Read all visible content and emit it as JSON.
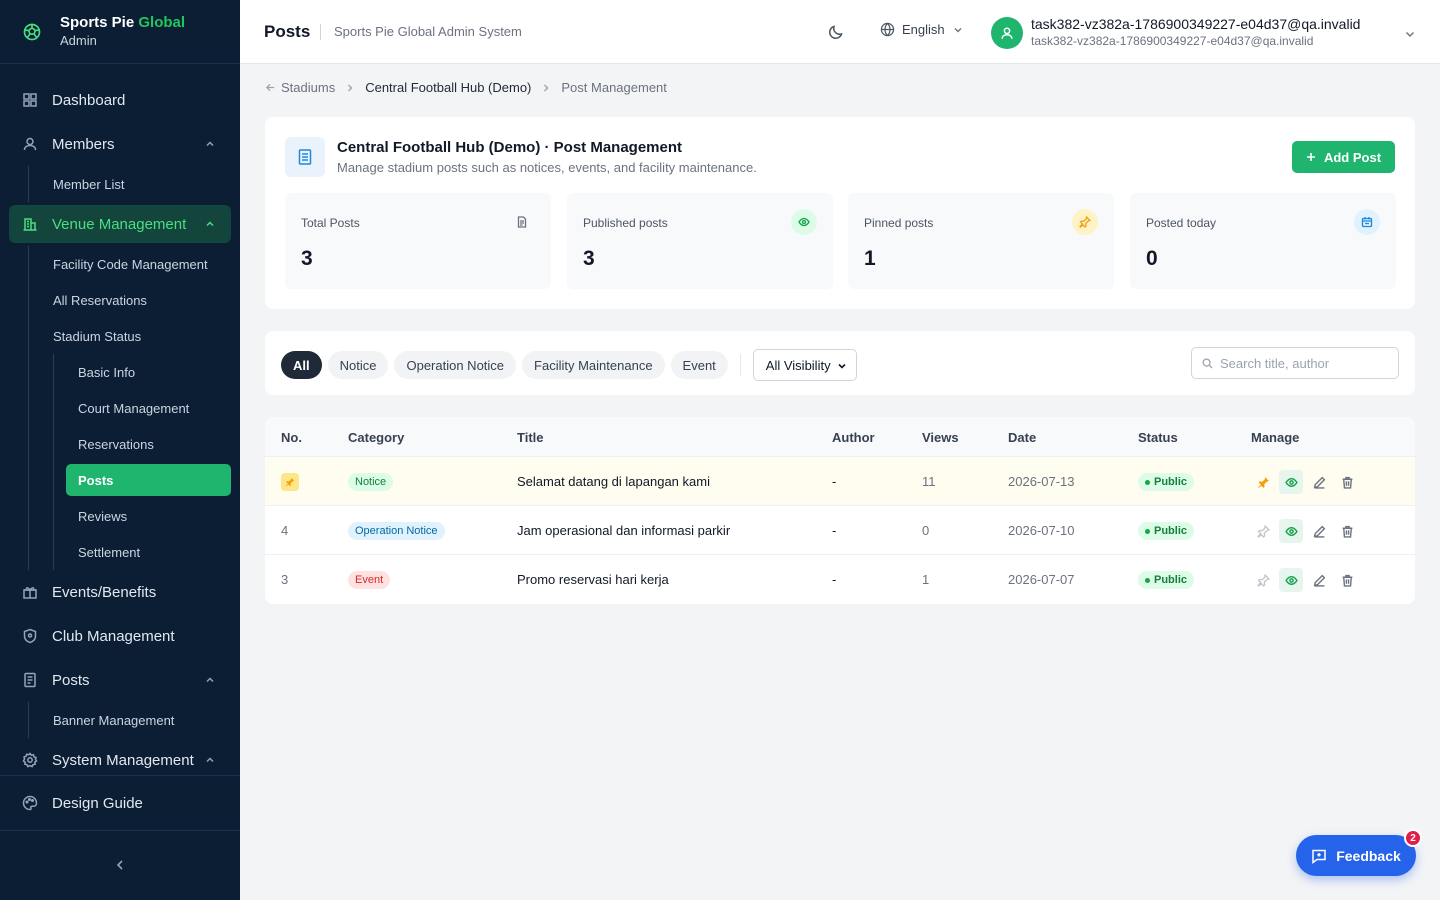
{
  "brand": {
    "name_main": "Sports Pie",
    "name_accent": "Global",
    "subtitle": "Admin"
  },
  "sidebar": {
    "dashboard": "Dashboard",
    "members": "Members",
    "member_list": "Member List",
    "venue_management": "Venue Management",
    "facility_code": "Facility Code Management",
    "all_reservations": "All Reservations",
    "stadium_status": "Stadium Status",
    "basic_info": "Basic Info",
    "court_management": "Court Management",
    "reservations": "Reservations",
    "posts_sub": "Posts",
    "reviews": "Reviews",
    "settlement": "Settlement",
    "events_benefits": "Events/Benefits",
    "club_management": "Club Management",
    "posts": "Posts",
    "banner_management": "Banner Management",
    "system_management": "System Management",
    "design_guide": "Design Guide"
  },
  "header": {
    "title": "Posts",
    "subtitle": "Sports Pie Global Admin System",
    "language": "English",
    "user_name": "task382-vz382a-1786900349227-e04d37@qa.invalid",
    "user_email": "task382-vz382a-1786900349227-e04d37@qa.invalid"
  },
  "breadcrumb": {
    "level1": "Stadiums",
    "level2": "Central Football Hub (Demo)",
    "level3": "Post Management"
  },
  "summary": {
    "title": "Central Football Hub (Demo) · Post Management",
    "description": "Manage stadium posts such as notices, events, and facility maintenance.",
    "add_label": "Add Post",
    "stats": [
      {
        "label": "Total Posts",
        "value": "3",
        "icon": "document-icon",
        "color": "#6b7280"
      },
      {
        "label": "Published posts",
        "value": "3",
        "icon": "eye-icon",
        "color": "#16a34a"
      },
      {
        "label": "Pinned posts",
        "value": "1",
        "icon": "pin-icon",
        "color": "#f59e0b"
      },
      {
        "label": "Posted today",
        "value": "0",
        "icon": "calendar-icon",
        "color": "#1e88d9"
      }
    ]
  },
  "filters": {
    "chips": [
      "All",
      "Notice",
      "Operation Notice",
      "Facility Maintenance",
      "Event"
    ],
    "visibility": "All Visibility",
    "search_placeholder": "Search title, author"
  },
  "table": {
    "headers": {
      "no": "No.",
      "category": "Category",
      "title": "Title",
      "author": "Author",
      "views": "Views",
      "date": "Date",
      "status": "Status",
      "manage": "Manage"
    },
    "rows": [
      {
        "no": "",
        "category": "Notice",
        "title": "Selamat datang di lapangan kami",
        "author": "-",
        "views": "11",
        "date": "2026-07-13",
        "status": "Public",
        "pinned": true
      },
      {
        "no": "4",
        "category": "Operation Notice",
        "title": "Jam operasional dan informasi parkir",
        "author": "-",
        "views": "0",
        "date": "2026-07-10",
        "status": "Public",
        "pinned": false
      },
      {
        "no": "3",
        "category": "Event",
        "title": "Promo reservasi hari kerja",
        "author": "-",
        "views": "1",
        "date": "2026-07-07",
        "status": "Public",
        "pinned": false
      }
    ]
  },
  "feedback": {
    "label": "Feedback",
    "count": "2"
  },
  "colors": {
    "brand_green": "#1fb56f",
    "sidebar_bg": "#0b1e33",
    "feedback_blue": "#2563eb"
  }
}
